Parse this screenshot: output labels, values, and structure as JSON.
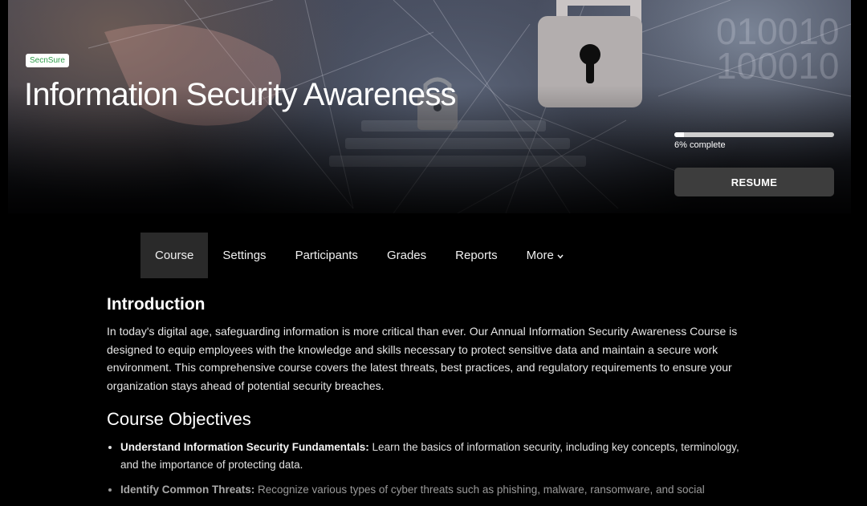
{
  "hero": {
    "brand_badge": "SecnSure",
    "title": "Information Security Awareness",
    "progress": {
      "percent": 6,
      "label": "6% complete"
    },
    "resume_label": "RESUME",
    "binary_lines": [
      "010010",
      "100010"
    ]
  },
  "nav": {
    "tabs": [
      {
        "label": "Course",
        "active": true
      },
      {
        "label": "Settings"
      },
      {
        "label": "Participants"
      },
      {
        "label": "Grades"
      },
      {
        "label": "Reports"
      },
      {
        "label": "More"
      }
    ]
  },
  "content": {
    "intro_heading": "Introduction",
    "intro_text": "In today's digital age, safeguarding information is more critical than ever. Our Annual Information Security Awareness Course is designed to equip employees with the knowledge and skills necessary to protect sensitive data and maintain a secure work environment. This comprehensive course covers the latest threats, best practices, and regulatory requirements to ensure your organization stays ahead of potential security breaches.",
    "objectives_heading": "Course Objectives",
    "objectives": [
      {
        "title": "Understand Information Security Fundamentals:",
        "text": " Learn the basics of information security, including key concepts, terminology, and the importance of protecting data."
      },
      {
        "title": "Identify Common Threats:",
        "text": " Recognize various types of cyber threats such as phishing, malware, ransomware, and social"
      }
    ]
  }
}
